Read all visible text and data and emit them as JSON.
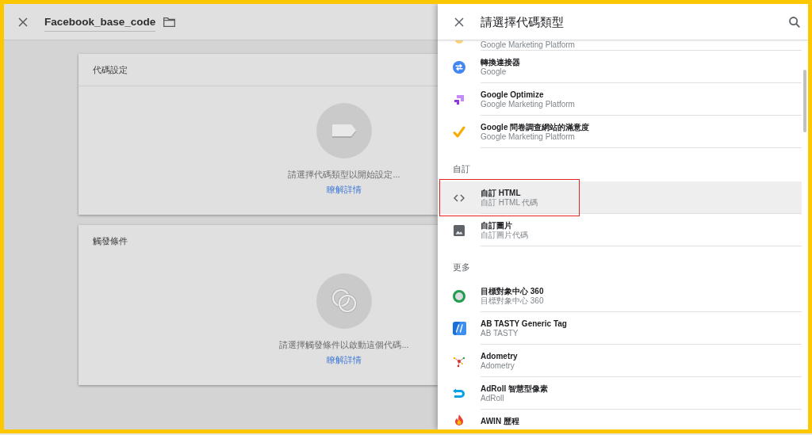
{
  "editor": {
    "title": "Facebook_base_code",
    "cards": [
      {
        "kind": "tag",
        "title": "代碼設定",
        "message": "請選擇代碼類型以開始設定...",
        "link": "瞭解詳情"
      },
      {
        "kind": "trigger",
        "title": "觸發條件",
        "message": "請選擇觸發條件以啟動這個代碼...",
        "link": "瞭解詳情"
      }
    ]
  },
  "panel": {
    "title": "請選擇代碼類型",
    "sections": [
      {
        "items": [
          {
            "kind": "partial",
            "subtitle": "Google Marketing Platform",
            "selected": false,
            "marked": false
          },
          {
            "kind": "linker",
            "title": "轉換連接器",
            "subtitle": "Google",
            "selected": false,
            "marked": false
          },
          {
            "kind": "optimize",
            "title": "Google Optimize",
            "subtitle": "Google Marketing Platform",
            "selected": false,
            "marked": false
          },
          {
            "kind": "survey",
            "title": "Google 問卷調查網站的滿意度",
            "subtitle": "Google Marketing Platform",
            "selected": false,
            "marked": false
          }
        ]
      },
      {
        "heading": "自訂",
        "items": [
          {
            "kind": "code",
            "title": "自訂 HTML",
            "subtitle": "自訂 HTML 代碼",
            "selected": true,
            "marked": true
          },
          {
            "kind": "image",
            "title": "自訂圖片",
            "subtitle": "自訂圖片代碼",
            "selected": false,
            "marked": false
          }
        ]
      },
      {
        "heading": "更多",
        "items": [
          {
            "kind": "audience",
            "title": "目標對象中心 360",
            "subtitle": "目標對象中心 360",
            "selected": false,
            "marked": false
          },
          {
            "kind": "abtasty",
            "title": "AB TASTY Generic Tag",
            "subtitle": "AB TASTY",
            "selected": false,
            "marked": false
          },
          {
            "kind": "adometry",
            "title": "Adometry",
            "subtitle": "Adometry",
            "selected": false,
            "marked": false
          },
          {
            "kind": "adroll",
            "title": "AdRoll 智慧型像素",
            "subtitle": "AdRoll",
            "selected": false,
            "marked": false
          },
          {
            "kind": "awin",
            "title": "AWIN 歷程",
            "selected": false,
            "marked": false
          }
        ]
      }
    ]
  }
}
